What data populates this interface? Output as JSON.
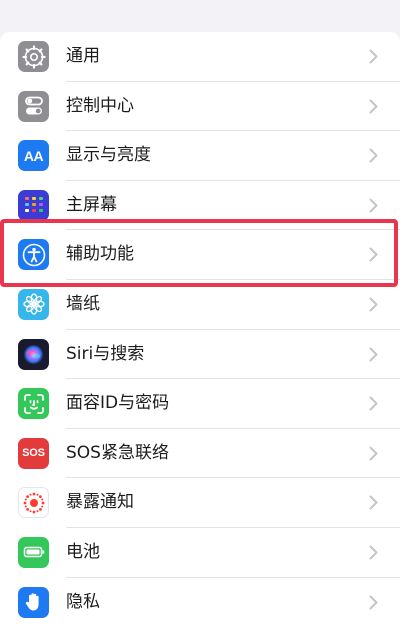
{
  "settings": {
    "items": [
      {
        "label": "通用",
        "icon": "gear-icon",
        "color": "#8e8e93"
      },
      {
        "label": "控制中心",
        "icon": "toggles-icon",
        "color": "#8e8e93"
      },
      {
        "label": "显示与亮度",
        "icon": "text-size-icon",
        "icon_text": "AA",
        "color": "#1e7af0"
      },
      {
        "label": "主屏幕",
        "icon": "home-screen-grid-icon",
        "color": "#3b3bd6"
      },
      {
        "label": "辅助功能",
        "icon": "accessibility-icon",
        "color": "#1e7af0",
        "highlighted": true
      },
      {
        "label": "墙纸",
        "icon": "flower-icon",
        "color": "#36b6ea"
      },
      {
        "label": "Siri与搜索",
        "icon": "siri-icon",
        "color": "#1a1a2e"
      },
      {
        "label": "面容ID与密码",
        "icon": "face-id-icon",
        "color": "#34c759"
      },
      {
        "label": "SOS紧急联络",
        "icon": "sos-icon",
        "icon_text": "SOS",
        "color": "#e33b3b"
      },
      {
        "label": "暴露通知",
        "icon": "exposure-notification-icon",
        "color": "#ffffff"
      },
      {
        "label": "电池",
        "icon": "battery-icon",
        "color": "#34c759"
      },
      {
        "label": "隐私",
        "icon": "hand-icon",
        "color": "#1e7af0"
      }
    ]
  }
}
